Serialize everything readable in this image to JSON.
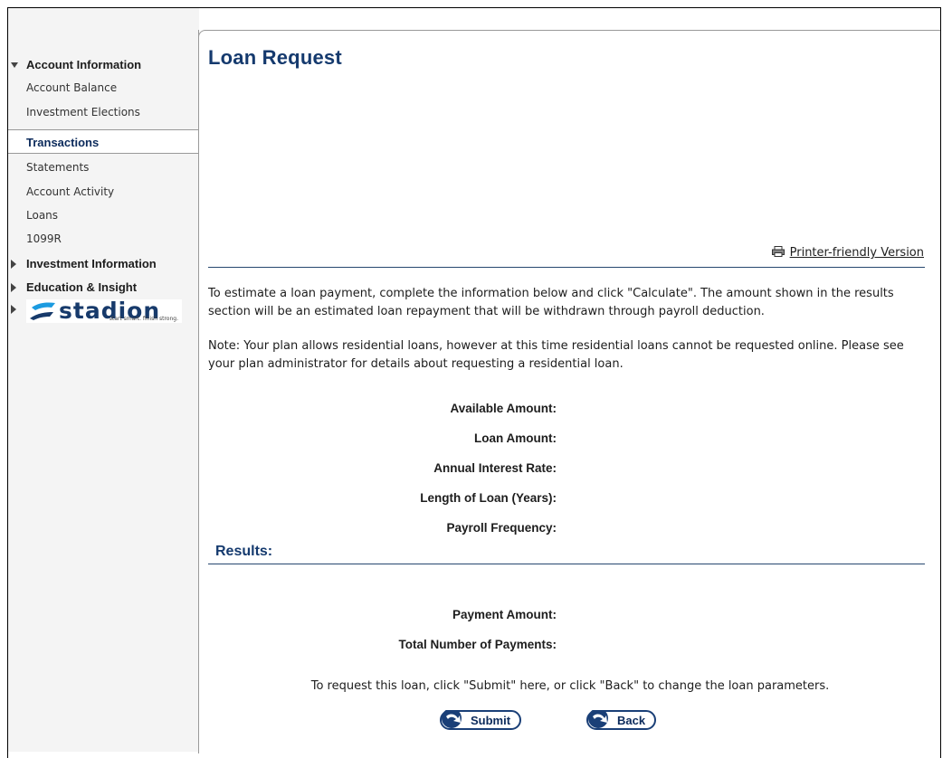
{
  "page": {
    "title": "Loan Request"
  },
  "sidebar": {
    "group_account": "Account Information",
    "account_items": [
      "Account Balance",
      "Investment Elections"
    ],
    "transactions_tab": "Transactions",
    "transactions_items": [
      "Statements",
      "Account Activity",
      "Loans",
      "1099R"
    ],
    "group_investment": "Investment Information",
    "group_education": "Education & Insight",
    "logo": {
      "word": "stadion",
      "tagline": "start smart. finish strong."
    }
  },
  "printer": {
    "label": "Printer-friendly Version",
    "icon": "printer-icon"
  },
  "intro": "To estimate a loan payment, complete the information below and click \"Calculate\". The amount shown in the results section will be an estimated loan repayment that will be withdrawn through payroll deduction.",
  "note": "Note: Your plan allows residential loans, however at this time residential loans cannot be requested online. Please see your plan administrator for details about requesting a residential loan.",
  "fields": {
    "available": "Available Amount:",
    "loan_amount": "Loan Amount:",
    "rate": "Annual Interest Rate:",
    "length": "Length of Loan (Years):",
    "frequency": "Payroll Frequency:"
  },
  "results": {
    "heading": "Results:",
    "payment": "Payment Amount:",
    "total": "Total Number of Payments:"
  },
  "request_note": "To request this loan, click \"Submit\" here, or click \"Back\" to change the loan parameters.",
  "buttons": {
    "submit": "Submit",
    "back": "Back"
  },
  "colors": {
    "brand": "#153a6e",
    "rule": "#26476f",
    "sidebar": "#f4f4f4"
  }
}
